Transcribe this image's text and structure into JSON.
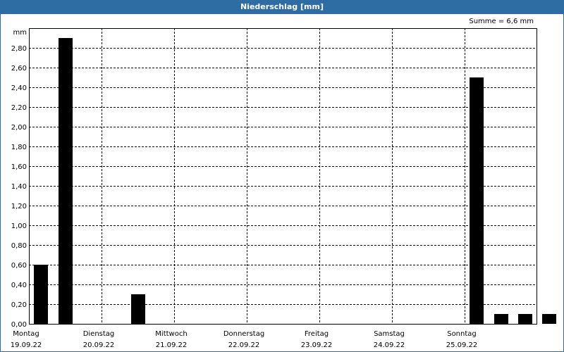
{
  "title": "Niederschlag [mm]",
  "summary": "Summe = 6,6 mm",
  "chart_data": {
    "type": "bar",
    "title": "Niederschlag [mm]",
    "ylabel": "mm",
    "xlabel": "",
    "ylim": [
      0,
      3.0
    ],
    "yticks": [
      "0,00",
      "0,20",
      "0,40",
      "0,60",
      "0,80",
      "1,00",
      "1,20",
      "1,40",
      "1,60",
      "1,80",
      "2,00",
      "2,20",
      "2,40",
      "2,60",
      "2,80"
    ],
    "days": [
      {
        "name": "Montag",
        "date": "19.09.22"
      },
      {
        "name": "Dienstag",
        "date": "20.09.22"
      },
      {
        "name": "Mittwoch",
        "date": "21.09.22"
      },
      {
        "name": "Donnerstag",
        "date": "22.09.22"
      },
      {
        "name": "Freitag",
        "date": "23.09.22"
      },
      {
        "name": "Samstag",
        "date": "24.09.22"
      },
      {
        "name": "Sonntag",
        "date": "25.09.22"
      }
    ],
    "periods_per_day": 3,
    "values": [
      0.6,
      2.9,
      0,
      0,
      0.3,
      0,
      0,
      0,
      0,
      0,
      0,
      0,
      0,
      0,
      0,
      0,
      0,
      0,
      2.5,
      0.1,
      0.1,
      0.1
    ],
    "bar_color": "#000000",
    "grid": true,
    "grid_style": "dashed"
  }
}
